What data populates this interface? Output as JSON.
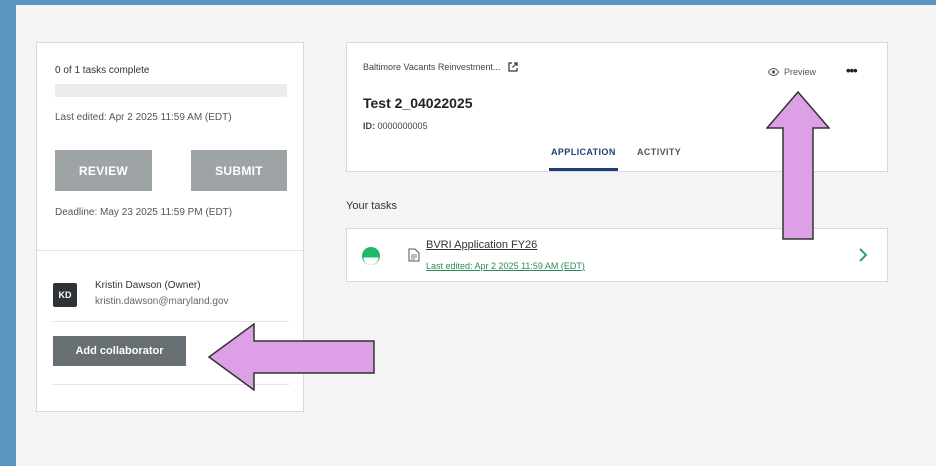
{
  "left_panel": {
    "tasks_complete": "0 of 1 tasks complete",
    "progress_fraction": 0,
    "last_edited": "Last edited: Apr 2 2025 11:59 AM (EDT)",
    "review_label": "REVIEW",
    "submit_label": "SUBMIT",
    "deadline": "Deadline: May 23 2025 11:59 PM (EDT)",
    "owner": {
      "initials": "KD",
      "name": "Kristin Dawson (Owner)",
      "email": "kristin.dawson@maryland.gov"
    },
    "add_collaborator_label": "Add collaborator"
  },
  "header": {
    "org_name": "Baltimore Vacants Reinvestment...",
    "preview_label": "Preview",
    "more_label": "•••",
    "title": "Test 2_04022025",
    "id_label": "ID:",
    "id_value": "0000000005",
    "tabs": [
      {
        "label": "APPLICATION",
        "active": true
      },
      {
        "label": "ACTIVITY",
        "active": false
      }
    ]
  },
  "tasks": {
    "heading": "Your tasks",
    "items": [
      {
        "name": "BVRI Application FY26",
        "last_edited": "Last edited: Apr 2 2025 11:59 AM (EDT)",
        "status_icon": "half-complete-status-icon"
      }
    ]
  },
  "colors": {
    "background_frame": "#5b94bf",
    "page_background": "#f3f4f3",
    "status_green": "#20b868",
    "accent_navy": "#1f3f74",
    "annotation_arrow_fill": "#dd9fe6",
    "button_gray": "#9ea3a6"
  }
}
